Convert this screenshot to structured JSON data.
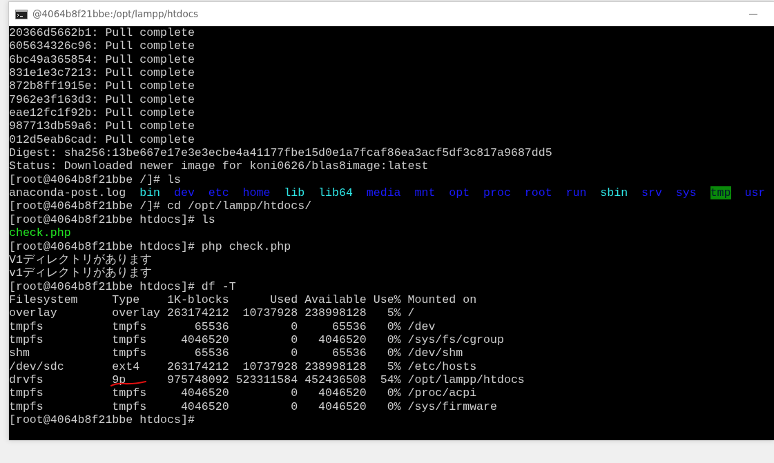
{
  "window": {
    "title": "@4064b8f21bbe:/opt/lampp/htdocs"
  },
  "terminal": {
    "lines_before": [
      {
        "text": "20366d5662b1: Pull complete"
      },
      {
        "text": "605634326c96: Pull complete"
      },
      {
        "text": "6bc49a365854: Pull complete"
      },
      {
        "text": "831e1e3c7213: Pull complete"
      },
      {
        "text": "872b8ff1915e: Pull complete"
      },
      {
        "text": "7962e3f163d3: Pull complete"
      },
      {
        "text": "eae12fc1f92b: Pull complete"
      },
      {
        "text": "987713db59a6: Pull complete"
      },
      {
        "text": "012d5eab6cad: Pull complete"
      },
      {
        "text": "Digest: sha256:13be667e17e3e3ecbe4a41177fbe15d0e1a7fcaf86ea3acf5df3c817a9687dd5"
      },
      {
        "text": "Status: Downloaded newer image for koni0626/blas8image:latest"
      },
      {
        "text": "[root@4064b8f21bbe /]# ls"
      },
      {
        "segments": [
          {
            "text": "anaconda-post.log",
            "kind": "file"
          },
          {
            "text": "bin",
            "kind": "link"
          },
          {
            "text": "dev",
            "kind": "dir"
          },
          {
            "text": "etc",
            "kind": "dir"
          },
          {
            "text": "home",
            "kind": "dir"
          },
          {
            "text": "lib",
            "kind": "link"
          },
          {
            "text": "lib64",
            "kind": "link"
          },
          {
            "text": "media",
            "kind": "dir"
          },
          {
            "text": "mnt",
            "kind": "dir"
          },
          {
            "text": "opt",
            "kind": "dir"
          },
          {
            "text": "proc",
            "kind": "dir"
          },
          {
            "text": "root",
            "kind": "dir"
          },
          {
            "text": "run",
            "kind": "dir"
          },
          {
            "text": "sbin",
            "kind": "link"
          },
          {
            "text": "srv",
            "kind": "dir"
          },
          {
            "text": "sys",
            "kind": "dir"
          },
          {
            "text": "tmp",
            "kind": "sticky"
          },
          {
            "text": "usr",
            "kind": "dir"
          }
        ]
      },
      {
        "text": "[root@4064b8f21bbe /]# cd /opt/lampp/htdocs/"
      },
      {
        "text": "[root@4064b8f21bbe htdocs]# ls"
      },
      {
        "segments": [
          {
            "text": "check.php",
            "kind": "exec"
          }
        ]
      },
      {
        "text": "[root@4064b8f21bbe htdocs]# php check.php"
      },
      {
        "text": "V1ディレクトリがあります"
      },
      {
        "text": "v1ディレクトリがあります"
      },
      {
        "text": "[root@4064b8f21bbe htdocs]# df -T"
      }
    ],
    "df_table": {
      "columns": [
        "Filesystem",
        "Type",
        "1K-blocks",
        "Used",
        "Available",
        "Use%",
        "Mounted on"
      ],
      "rows": [
        {
          "cells": [
            "overlay",
            "overlay",
            "263174212",
            "10737928",
            "238998128",
            "5%",
            "/"
          ]
        },
        {
          "cells": [
            "tmpfs",
            "tmpfs",
            "65536",
            "0",
            "65536",
            "0%",
            "/dev"
          ]
        },
        {
          "cells": [
            "tmpfs",
            "tmpfs",
            "4046520",
            "0",
            "4046520",
            "0%",
            "/sys/fs/cgroup"
          ]
        },
        {
          "cells": [
            "shm",
            "tmpfs",
            "65536",
            "0",
            "65536",
            "0%",
            "/dev/shm"
          ]
        },
        {
          "cells": [
            "/dev/sdc",
            "ext4",
            "263174212",
            "10737928",
            "238998128",
            "5%",
            "/etc/hosts"
          ]
        },
        {
          "cells": [
            "drvfs",
            "9p",
            "975748092",
            "523311584",
            "452436508",
            "54%",
            "/opt/lampp/htdocs"
          ],
          "type_underlined": true
        },
        {
          "cells": [
            "tmpfs",
            "tmpfs",
            "4046520",
            "0",
            "4046520",
            "0%",
            "/proc/acpi"
          ]
        },
        {
          "cells": [
            "tmpfs",
            "tmpfs",
            "4046520",
            "0",
            "4046520",
            "0%",
            "/sys/firmware"
          ]
        }
      ]
    },
    "lines_after": [
      {
        "text": "[root@4064b8f21bbe htdocs]#"
      }
    ]
  }
}
